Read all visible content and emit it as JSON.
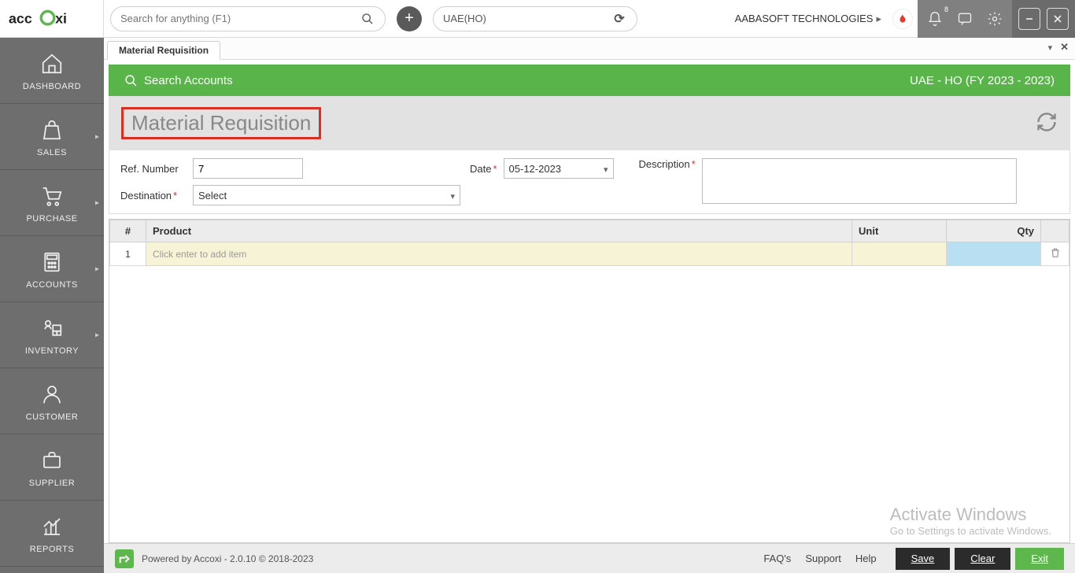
{
  "topbar": {
    "search_placeholder": "Search for anything (F1)",
    "org": "UAE(HO)",
    "company": "AABASOFT TECHNOLOGIES",
    "notif_count": "8"
  },
  "sidebar": {
    "items": [
      {
        "label": "DASHBOARD",
        "has_sub": false
      },
      {
        "label": "SALES",
        "has_sub": true
      },
      {
        "label": "PURCHASE",
        "has_sub": true
      },
      {
        "label": "ACCOUNTS",
        "has_sub": true
      },
      {
        "label": "INVENTORY",
        "has_sub": true
      },
      {
        "label": "CUSTOMER",
        "has_sub": false
      },
      {
        "label": "SUPPLIER",
        "has_sub": false
      },
      {
        "label": "REPORTS",
        "has_sub": false
      }
    ]
  },
  "tabs": {
    "active": "Material Requisition"
  },
  "greenbar": {
    "search_label": "Search Accounts",
    "context": "UAE - HO (FY 2023 - 2023)"
  },
  "page": {
    "title": "Material Requisition"
  },
  "form": {
    "ref_label": "Ref. Number",
    "ref_value": "7",
    "date_label": "Date",
    "date_value": "05-12-2023",
    "destination_label": "Destination",
    "destination_value": "Select",
    "description_label": "Description",
    "description_value": ""
  },
  "table": {
    "headers": {
      "num": "#",
      "product": "Product",
      "unit": "Unit",
      "qty": "Qty"
    },
    "rows": [
      {
        "num": "1",
        "product_placeholder": "Click enter to add item",
        "unit": "",
        "qty": ""
      }
    ]
  },
  "watermark": {
    "line1": "Activate Windows",
    "line2": "Go to Settings to activate Windows."
  },
  "footer": {
    "powered": "Powered by Accoxi - 2.0.10 © 2018-2023",
    "faqs": "FAQ's",
    "support": "Support",
    "help": "Help",
    "save": "Save",
    "clear": "Clear",
    "exit": "Exit"
  }
}
